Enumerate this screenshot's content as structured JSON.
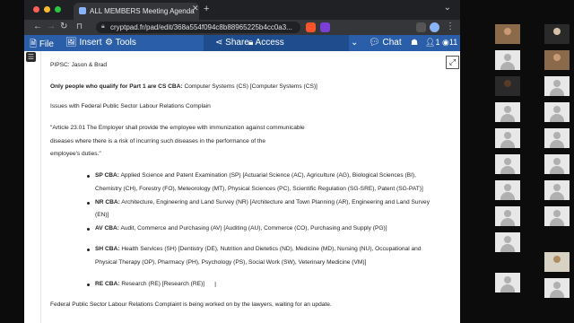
{
  "browser": {
    "tab_title": "ALL MEMBERS Meeting Agenda",
    "url": "cryptpad.fr/pad/edit/368a554f094c8b88965225b4cc0a3..."
  },
  "toolbar": {
    "file": "File",
    "insert": "Insert",
    "tools": "Tools",
    "share": "Share",
    "access": "Access",
    "chat": "Chat",
    "users_count": "1",
    "views_count": "11"
  },
  "document": {
    "line1": "PIPSC: Jason & Brad",
    "line2_bold": "Only people who qualify for Part 1 are CS CBA:",
    "line2_rest": " Computer Systems (CS) [Computer Systems (CS)]",
    "line3": "Issues with Federal Public Sector Labour Relations Complain",
    "quote1": "\"Article 23.01 The Employer shall provide the employee with immunization against communicable",
    "quote2": "diseases where there is a risk of incurring such diseases in the performance of the",
    "quote3": "employee's duties.\"",
    "bullets": [
      {
        "bold": "SP CBA:",
        "line1": " Applied Science and Patent Examination (SP) [Actuarial Science (AC), Agriculture (AG), Biological Sciences (BI),",
        "line2": "Chemistry (CH), Forestry (FO), Meteorology (MT), Physical Sciences (PC), Scientific Regulation (SG-SRE), Patent (SG-PAT)]"
      },
      {
        "bold": "NR CBA:",
        "line1": " Architecture, Engineering and Land Survey (NR) [Architecture and Town Planning (AR), Engineering and Land Survey",
        "line2": "(EN)]"
      },
      {
        "bold": "AV CBA:",
        "line1": " Audit, Commerce and Purchasing (AV) [Auditing (AU), Commerce (CO), Purchasing and Supply (PG)]",
        "line2": ""
      },
      {
        "bold": "SH CBA:",
        "line1": " Health Services (SH) [Dentistry (DE), Nutrition and Dietetics (ND), Medicine (MD), Nursing (NU), Occupational and",
        "line2": "Physical Therapy (OP), Pharmacy (PH), Psychology (PS), Social Work (SW), Veterinary Medicine (VM)]"
      },
      {
        "bold": "RE CBA:",
        "line1": " Research (RE) [Research (RE)]",
        "line2": ""
      }
    ],
    "footer_line": "Federal Public Sector Labour Relations Complaint is being worked on by the lawyers, waiting for an update."
  },
  "icons": {
    "hamburger": "menu-icon",
    "expand": "expand-icon"
  },
  "colors": {
    "toolbar_blue": "#2b5ea8",
    "browser_chrome": "#202124"
  }
}
